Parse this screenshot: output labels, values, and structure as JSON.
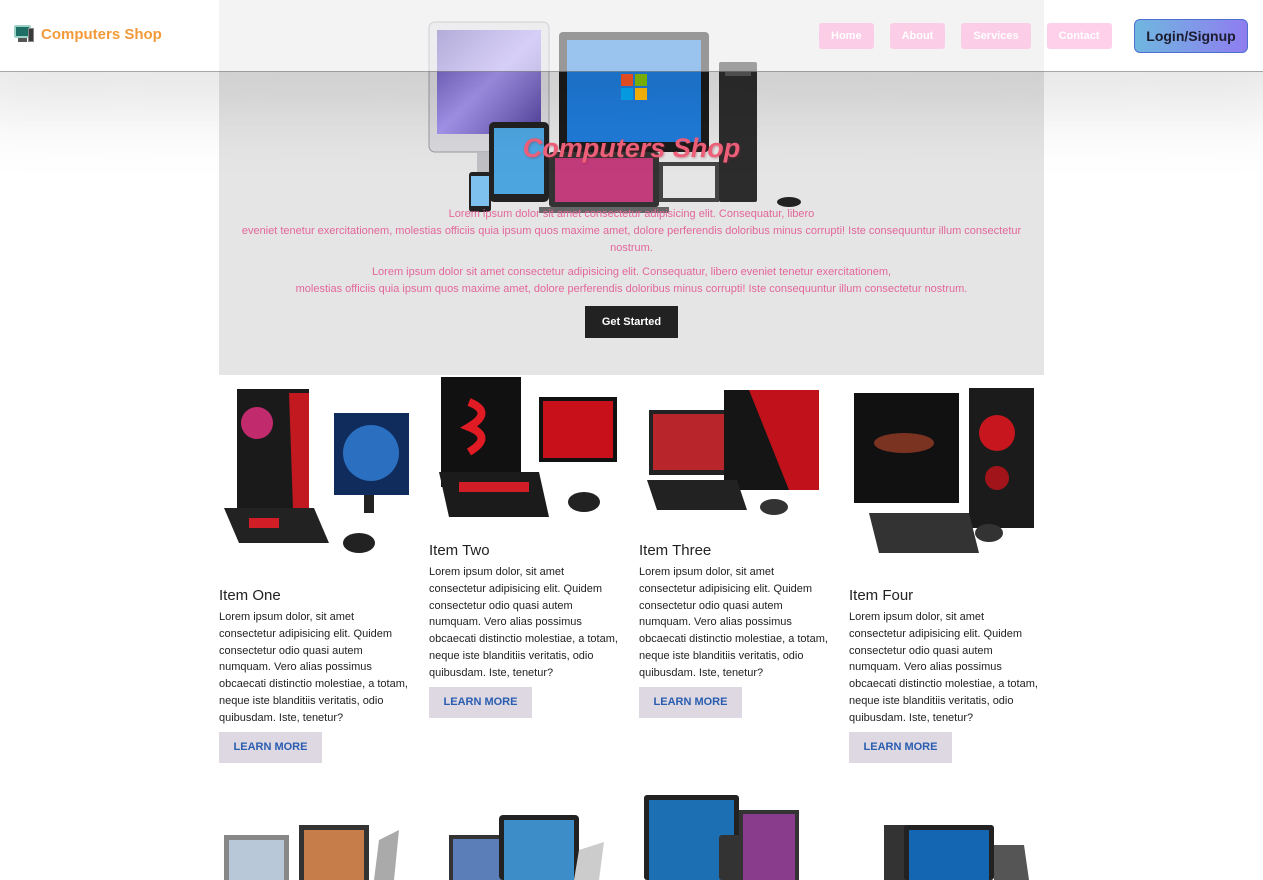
{
  "nav": {
    "brand": "Computers Shop",
    "links": [
      "Home",
      "About",
      "Services",
      "Contact"
    ],
    "login": "Login/Signup"
  },
  "hero": {
    "title": "Computers Shop",
    "paragraph1_line1": "Lorem ipsum dolor sit amet consectetur adipisicing elit. Consequatur, libero",
    "paragraph1_line2": "eveniet tenetur exercitationem, molestias officiis quia ipsum quos maxime amet, dolore perferendis doloribus minus corrupti! Iste consequuntur illum consectetur nostrum.",
    "paragraph2_line1": "Lorem ipsum dolor sit amet consectetur adipisicing elit. Consequatur, libero eveniet tenetur exercitationem,",
    "paragraph2_line2": "molestias officiis quia ipsum quos maxime amet, dolore perferendis doloribus minus corrupti! Iste consequuntur illum consectetur nostrum.",
    "cta": "Get Started"
  },
  "items": [
    {
      "title": "Item One",
      "text": "Lorem ipsum dolor, sit amet consectetur adipisicing elit. Quidem consectetur odio quasi autem numquam. Vero alias possimus obcaecati distinctio molestiae, a totam, neque iste blanditiis veritatis, odio quibusdam. Iste, tenetur?",
      "button": "LEARN MORE"
    },
    {
      "title": "Item Two",
      "text": "Lorem ipsum dolor, sit amet consectetur adipisicing elit. Quidem consectetur odio quasi autem numquam. Vero alias possimus obcaecati distinctio molestiae, a totam, neque iste blanditiis veritatis, odio quibusdam. Iste, tenetur?",
      "button": "LEARN MORE"
    },
    {
      "title": "Item Three",
      "text": "Lorem ipsum dolor, sit amet consectetur adipisicing elit. Quidem consectetur odio quasi autem numquam. Vero alias possimus obcaecati distinctio molestiae, a totam, neque iste blanditiis veritatis, odio quibusdam. Iste, tenetur?",
      "button": "LEARN MORE"
    },
    {
      "title": "Item Four",
      "text": "Lorem ipsum dolor, sit amet consectetur adipisicing elit. Quidem consectetur odio quasi autem numquam. Vero alias possimus obcaecati distinctio molestiae, a totam, neque iste blanditiis veritatis, odio quibusdam. Iste, tenetur?",
      "button": "LEARN MORE"
    }
  ],
  "colors": {
    "brand": "#f29a3a",
    "hero_title": "#f0607a",
    "hero_text": "#e3679a",
    "learn_more_text": "#2a5db0",
    "learn_more_bg": "#ddd8e2"
  }
}
